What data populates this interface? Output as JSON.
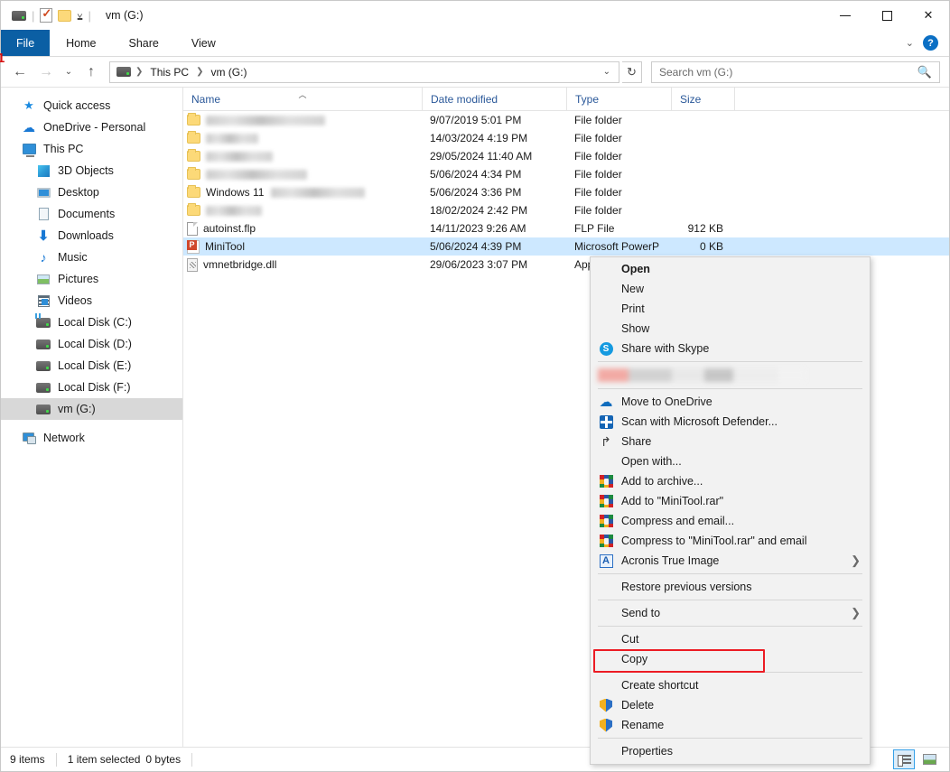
{
  "window": {
    "title": "vm (G:)",
    "quick_access_icons": [
      "drive-icon",
      "properties-checkbox-icon",
      "new-folder-icon",
      "customize-caret-icon"
    ],
    "controls": {
      "minimize": "—",
      "maximize": "▢",
      "close": "✕"
    }
  },
  "ribbon": {
    "tabs": [
      {
        "label": "File",
        "active": true
      },
      {
        "label": "Home",
        "active": false
      },
      {
        "label": "Share",
        "active": false
      },
      {
        "label": "View",
        "active": false
      }
    ],
    "collapse_icon": "chevron-down-icon",
    "help_label": "?"
  },
  "addressbar": {
    "back_icon": "←",
    "forward_icon": "→",
    "recent_icon": "⌄",
    "up_icon": "↑",
    "breadcrumbs": [
      "This PC",
      "vm (G:)"
    ],
    "dropdown_icon": "⌄",
    "refresh_icon": "↻"
  },
  "search": {
    "placeholder": "Search vm (G:)",
    "icon": "search-icon"
  },
  "sidebar": {
    "items": [
      {
        "label": "Quick access",
        "icon": "star-icon",
        "level": 0,
        "selected": false
      },
      {
        "label": "OneDrive - Personal",
        "icon": "cloud-icon",
        "level": 0,
        "selected": false
      },
      {
        "label": "This PC",
        "icon": "computer-icon",
        "level": 0,
        "selected": false
      },
      {
        "label": "3D Objects",
        "icon": "cube-icon",
        "level": 1,
        "selected": false
      },
      {
        "label": "Desktop",
        "icon": "monitor-icon",
        "level": 1,
        "selected": false
      },
      {
        "label": "Documents",
        "icon": "document-icon",
        "level": 1,
        "selected": false
      },
      {
        "label": "Downloads",
        "icon": "download-arrow-icon",
        "level": 1,
        "selected": false
      },
      {
        "label": "Music",
        "icon": "music-note-icon",
        "level": 1,
        "selected": false
      },
      {
        "label": "Pictures",
        "icon": "picture-icon",
        "level": 1,
        "selected": false
      },
      {
        "label": "Videos",
        "icon": "video-icon",
        "level": 1,
        "selected": false
      },
      {
        "label": "Local Disk (C:)",
        "icon": "system-drive-icon",
        "level": 1,
        "selected": false
      },
      {
        "label": "Local Disk (D:)",
        "icon": "drive-icon",
        "level": 1,
        "selected": false
      },
      {
        "label": "Local Disk (E:)",
        "icon": "drive-icon",
        "level": 1,
        "selected": false
      },
      {
        "label": "Local Disk (F:)",
        "icon": "drive-icon",
        "level": 1,
        "selected": false
      },
      {
        "label": "vm (G:)",
        "icon": "drive-icon",
        "level": 1,
        "selected": true
      },
      {
        "label": "Network",
        "icon": "network-icon",
        "level": 0,
        "selected": false
      }
    ]
  },
  "filelist": {
    "columns": [
      {
        "label": "Name",
        "sorted": true,
        "sort_icon": "sort-ascending-caret"
      },
      {
        "label": "Date modified",
        "sorted": false
      },
      {
        "label": "Type",
        "sorted": false
      },
      {
        "label": "Size",
        "sorted": false
      }
    ],
    "rows": [
      {
        "name": "",
        "redacted": true,
        "redact_width": 132,
        "date": "9/07/2019 5:01 PM",
        "type": "File folder",
        "size": "",
        "icon": "folder-icon",
        "selected": false
      },
      {
        "name": "",
        "redacted": true,
        "redact_width": 58,
        "date": "14/03/2024 4:19 PM",
        "type": "File folder",
        "size": "",
        "icon": "folder-icon",
        "selected": false
      },
      {
        "name": "",
        "redacted": true,
        "redact_width": 74,
        "date": "29/05/2024 11:40 AM",
        "type": "File folder",
        "size": "",
        "icon": "folder-icon",
        "selected": false
      },
      {
        "name": "",
        "redacted": true,
        "redact_width": 112,
        "date": "5/06/2024 4:34 PM",
        "type": "File folder",
        "size": "",
        "icon": "folder-icon",
        "selected": false
      },
      {
        "name": "Windows 11",
        "redacted": true,
        "redact_width": 104,
        "redact_after": true,
        "date": "5/06/2024 3:36 PM",
        "type": "File folder",
        "size": "",
        "icon": "folder-icon",
        "selected": false
      },
      {
        "name": "",
        "redacted": true,
        "redact_width": 62,
        "date": "18/02/2024 2:42 PM",
        "type": "File folder",
        "size": "",
        "icon": "folder-icon",
        "selected": false
      },
      {
        "name": "autoinst.flp",
        "redacted": false,
        "date": "14/11/2023 9:26 AM",
        "type": "FLP File",
        "size": "912 KB",
        "icon": "generic-file-icon",
        "selected": false
      },
      {
        "name": "MiniTool",
        "redacted": false,
        "date": "5/06/2024 4:39 PM",
        "type": "Microsoft PowerP",
        "size": "0 KB",
        "icon": "powerpoint-icon",
        "selected": true
      },
      {
        "name": "vmnetbridge.dll",
        "redacted": false,
        "date": "29/06/2023 3:07 PM",
        "type": "Appl",
        "size": "",
        "icon": "dll-icon",
        "selected": false
      }
    ]
  },
  "contextmenu": {
    "items": [
      {
        "label": "Open",
        "icon": "",
        "bold": true,
        "arrow": false
      },
      {
        "label": "New",
        "icon": "",
        "bold": false,
        "arrow": false
      },
      {
        "label": "Print",
        "icon": "",
        "bold": false,
        "arrow": false
      },
      {
        "label": "Show",
        "icon": "",
        "bold": false,
        "arrow": false
      },
      {
        "label": "Share with Skype",
        "icon": "skype-icon",
        "bold": false,
        "arrow": false
      },
      {
        "type": "separator"
      },
      {
        "type": "blurred",
        "label": "",
        "icon": "redacted-icon"
      },
      {
        "type": "separator"
      },
      {
        "label": "Move to OneDrive",
        "icon": "onedrive-cloud-icon",
        "bold": false,
        "arrow": false
      },
      {
        "label": "Scan with Microsoft Defender...",
        "icon": "defender-shield-icon",
        "bold": false,
        "arrow": false
      },
      {
        "label": "Share",
        "icon": "share-arrow-icon",
        "bold": false,
        "arrow": false
      },
      {
        "label": "Open with...",
        "icon": "",
        "bold": false,
        "arrow": false
      },
      {
        "label": "Add to archive...",
        "icon": "winrar-icon",
        "bold": false,
        "arrow": false
      },
      {
        "label": "Add to \"MiniTool.rar\"",
        "icon": "winrar-icon",
        "bold": false,
        "arrow": false
      },
      {
        "label": "Compress and email...",
        "icon": "winrar-icon",
        "bold": false,
        "arrow": false
      },
      {
        "label": "Compress to \"MiniTool.rar\" and email",
        "icon": "winrar-icon",
        "bold": false,
        "arrow": false
      },
      {
        "label": "Acronis True Image",
        "icon": "acronis-icon",
        "bold": false,
        "arrow": true
      },
      {
        "type": "separator"
      },
      {
        "label": "Restore previous versions",
        "icon": "",
        "bold": false,
        "arrow": false
      },
      {
        "type": "separator"
      },
      {
        "label": "Send to",
        "icon": "",
        "bold": false,
        "arrow": true
      },
      {
        "type": "separator"
      },
      {
        "label": "Cut",
        "icon": "",
        "bold": false,
        "arrow": false
      },
      {
        "label": "Copy",
        "icon": "",
        "bold": false,
        "arrow": false,
        "highlighted": true
      },
      {
        "type": "separator"
      },
      {
        "label": "Create shortcut",
        "icon": "",
        "bold": false,
        "arrow": false
      },
      {
        "label": "Delete",
        "icon": "uac-shield-icon",
        "bold": false,
        "arrow": false
      },
      {
        "label": "Rename",
        "icon": "uac-shield-icon",
        "bold": false,
        "arrow": false
      },
      {
        "type": "separator"
      },
      {
        "label": "Properties",
        "icon": "",
        "bold": false,
        "arrow": false
      }
    ]
  },
  "annotation": {
    "marker_label": "1",
    "highlight_color": "#ec1c24",
    "highlight_target": "Copy"
  },
  "statusbar": {
    "item_count": "9 items",
    "selection": "1 item selected",
    "selection_size": "0 bytes",
    "view_details_icon": "details-view-icon",
    "view_thumbnails_icon": "thumbnail-view-icon",
    "active_view": "details"
  },
  "colors": {
    "accent": "#0b5fa4",
    "selection": "#cde8ff",
    "sidebar_selection": "#d8d8d8",
    "annotation_red": "#ec1c24",
    "column_header_text": "#2a5899"
  }
}
